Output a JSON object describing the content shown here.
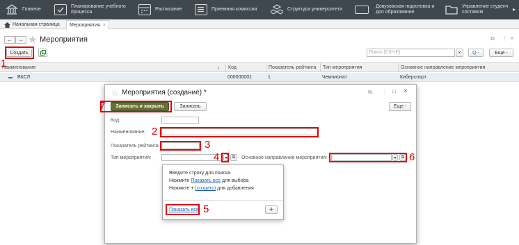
{
  "topbar": {
    "sections": [
      {
        "icon": "home-icon",
        "label": "Главное"
      },
      {
        "icon": "checkbox-icon",
        "label": "Планирование учебного\nпроцесса"
      },
      {
        "icon": "calendar-icon",
        "label": "Расписание"
      },
      {
        "icon": "list-icon",
        "label": "Приемная комиссия"
      },
      {
        "icon": "structure-icon",
        "label": "Структура университета"
      },
      {
        "icon": "monitor-icon",
        "label": "Довузовская подготовка и\nдоп образование"
      },
      {
        "icon": "folder-icon",
        "label": "Управление студенч\nсоставом"
      }
    ]
  },
  "tabs": {
    "home": "Начальная страница",
    "events": "Мероприятия",
    "close": "×"
  },
  "window": {
    "title": "Мероприятия"
  },
  "toolbar": {
    "create": "Создать",
    "search_placeholder": "Поиск (Ctrl+F)",
    "clear": "×",
    "search_btn": "Q -",
    "more": "Еще -"
  },
  "grid": {
    "columns": [
      "Наименование",
      "Код",
      "Показатель рейтинга",
      "Тип мероприятия",
      "Основное направление мероприятия"
    ],
    "sort_indicator": "↓",
    "rows": [
      {
        "name": "ВКСЛ",
        "code": "000000001",
        "rating": "1",
        "type": "Чемпионат",
        "direction": "Киберспорт"
      }
    ]
  },
  "dialog": {
    "title": "Мероприятия (создание) *",
    "save_close": "Записать и закрыть",
    "save": "Записать",
    "more": "Еще -",
    "code_label": "Код:",
    "name_label": "Наименование:",
    "rating_label": "Показатель рейтинга:",
    "type_label": "Тип мероприятия:",
    "direction_label": "Основное направление мероприятия:",
    "link_glyph": "⧉",
    "menu_glyph": "⋮",
    "max_glyph": "□",
    "close_glyph": "×"
  },
  "popup": {
    "line1": "Введите строку для поиска",
    "line2_prefix": "Нажмите",
    "line2_link": "Показать все",
    "line2_suffix": "для выбора",
    "line3_prefix": "Нажмите",
    "line3_link": "(создать)",
    "line3_suffix": "для добавления",
    "show_all": "Показать все",
    "add": "+"
  },
  "annotations": [
    "1",
    "2",
    "3",
    "4",
    "5",
    "6",
    "7"
  ],
  "colors": {
    "topbar": "#40484f",
    "accent_red": "#e00000",
    "save_close_bg": "#6b6e34",
    "link": "#1a63b8",
    "add_green": "#2a9a2a"
  }
}
